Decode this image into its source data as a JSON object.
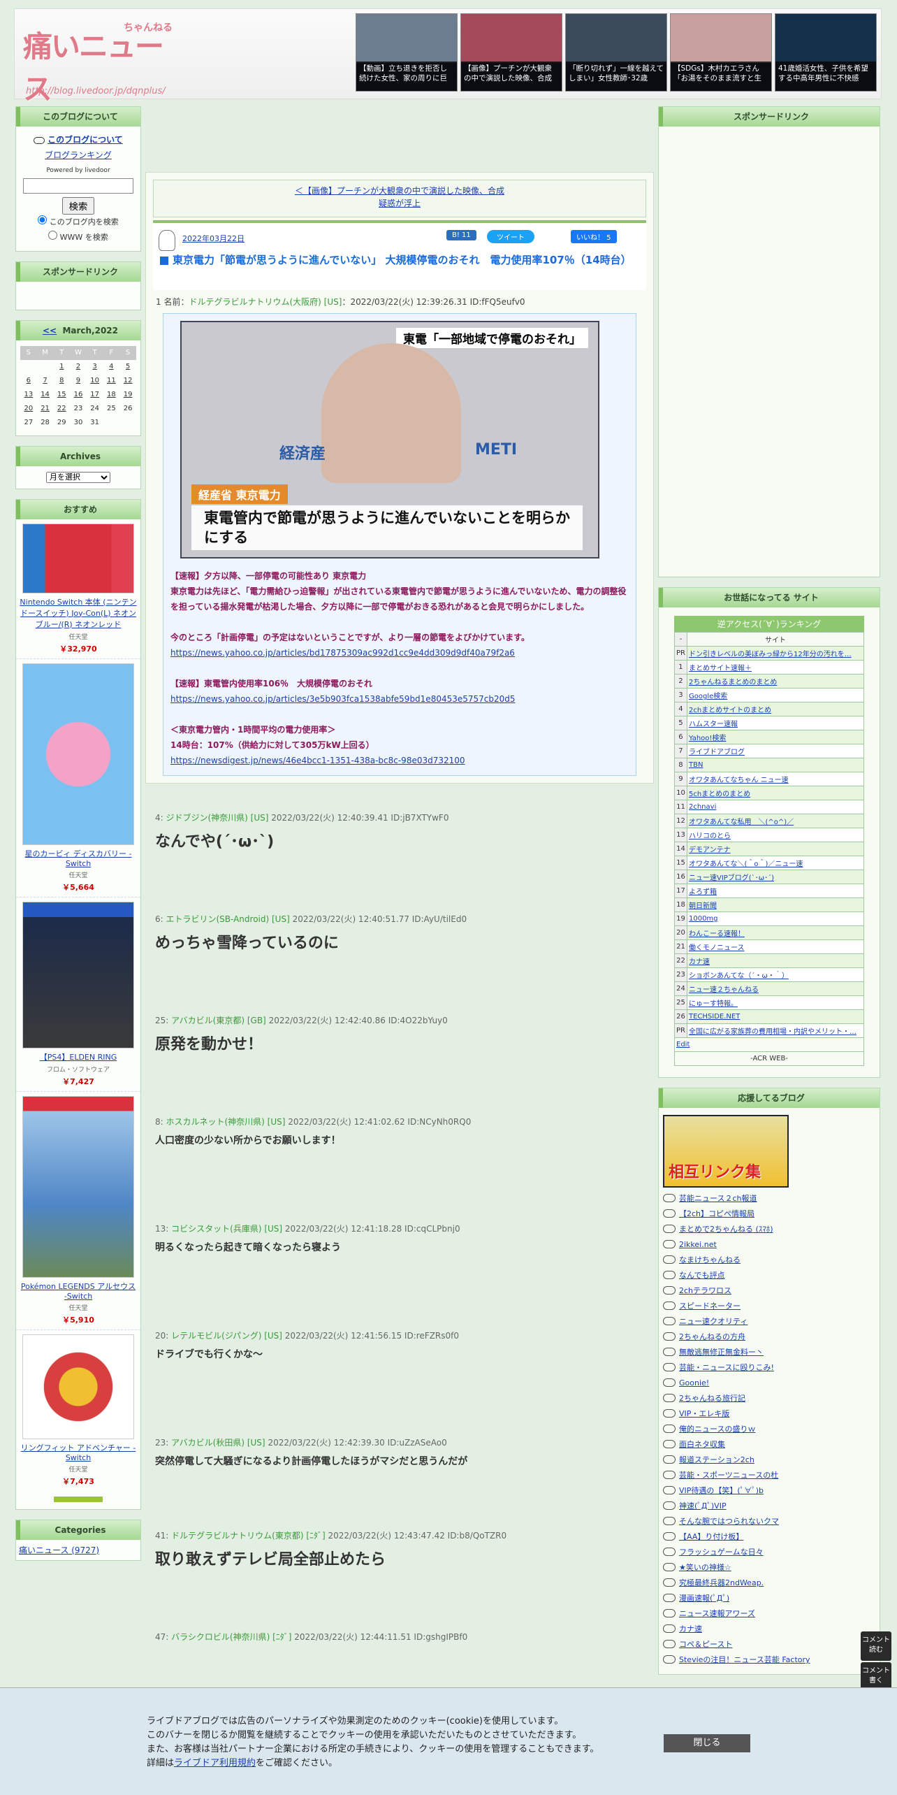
{
  "header": {
    "logo_main": "痛いニュース",
    "logo_sub": "ちゃんねる",
    "logo_url": "http://blog.livedoor.jp/dqnplus/",
    "thumbs": [
      {
        "caption": "【動画】立ち退きを拒否し続けた女性、家の周りに巨",
        "color": "#6b7d8f"
      },
      {
        "caption": "【画像】プーチンが大観衆の中で演説した映像、合成",
        "color": "#a44a5a"
      },
      {
        "caption": "「断り切れず」一線を越えてしまい」女性教師･32歳",
        "color": "#3b4b5c"
      },
      {
        "caption": "【SDGs】木村カエラさん「お湯をそのまま流すと生",
        "color": "#c9a0a0"
      },
      {
        "caption": "41歳婚活女性、子供を希望する中高年男性に不快感",
        "color": "#14304a"
      }
    ]
  },
  "left": {
    "about_title": "このブログについて",
    "about_link": "このブログについて",
    "ranking_link": "ブログランキング",
    "powered_by": "Powered by livedoor",
    "search_button": "検索",
    "radio_blog": "このブログ内を検索",
    "radio_www": "WWW を検索",
    "sponsor_title": "スポンサードリンク",
    "calendar": {
      "title": "March,2022",
      "prev": "<<",
      "days": [
        "S",
        "M",
        "T",
        "W",
        "T",
        "F",
        "S"
      ],
      "weeks": [
        [
          "",
          "",
          "1",
          "2",
          "3",
          "4",
          "5"
        ],
        [
          "6",
          "7",
          "8",
          "9",
          "10",
          "11",
          "12"
        ],
        [
          "13",
          "14",
          "15",
          "16",
          "17",
          "18",
          "19"
        ],
        [
          "20",
          "21",
          "22",
          "23",
          "24",
          "25",
          "26"
        ],
        [
          "27",
          "28",
          "29",
          "30",
          "31",
          "",
          ""
        ]
      ]
    },
    "archives_title": "Archives",
    "archives_select": "月を選択",
    "recommend_title": "おすすめ",
    "products": [
      {
        "name": "Nintendo Switch 本体 (ニンテンドースイッチ) Joy-Con(L) ネオンブルー/(R) ネオンレッド",
        "seller": "任天堂",
        "price": "￥32,970",
        "color": "#d9323c"
      },
      {
        "name": "星のカービィ ディスカバリー -Switch",
        "seller": "任天堂",
        "price": "￥5,664",
        "color": "#f2a5c5"
      },
      {
        "name": "【PS4】ELDEN RING",
        "seller": "フロム・ソフトウェア",
        "price": "￥7,427",
        "color": "#1c2b4a"
      },
      {
        "name": "Pokémon LEGENDS アルセウス -Switch",
        "seller": "任天堂",
        "price": "￥5,910",
        "color": "#4f86c6"
      },
      {
        "name": "リングフィット アドベンチャー -Switch",
        "seller": "任天堂",
        "price": "￥7,473",
        "color": "#d84040"
      }
    ],
    "categories_title": "Categories",
    "category_first": "痛いニュース (9727)"
  },
  "main": {
    "nav_prev": "＜【画像】プーチンが大観衆の中で演説した映像、合成",
    "nav_prev2": "疑惑が浮上",
    "date": "2022年03月22日",
    "share_b": "B! 11",
    "share_tweet": "ツイート",
    "share_like": "いいね！ 5",
    "title": "東京電力「節電が思うように進んでいない」 大規模停電のおそれ　電力使用率107％（14時台）",
    "op_num": "1",
    "op_name_label": "名前：",
    "op_name": "ドルテグラビルナトリウム(大阪府) [US]",
    "op_meta": "：2022/03/22(火) 12:39:26.31 ID:fFQ5eufv0",
    "img_caption_top": "東電「一部地域で停電のおそれ」",
    "img_tag": "経産省 東京電力",
    "img_caption": "東電管内で節電が思うように進んでいないことを明らかにする",
    "img_logo1": "経済産",
    "img_logo2": "METI",
    "quote_lines": [
      "【速報】夕方以降、一部停電の可能性あり 東京電力",
      "東京電力は先ほど、「電力需給ひっ迫警報」が出されている東電管内で節電が思うように進んでいないため、電力の調整役を担っている揚水発電が枯渇した場合、夕方以降に一部で停電がおきる恐れがあると会見で明らかにしました。",
      "",
      "今のところ「計画停電」の予定はないということですが、より一層の節電をよびかけています。"
    ],
    "link1": "https://news.yahoo.co.jp/articles/bd17875309ac992d1cc9e4dd309d9df40a79f2a6",
    "quote2": "【速報】東電管内使用率106％　大規模停電のおそれ",
    "link2": "https://news.yahoo.co.jp/articles/3e5b903fca1538abfe59bd1e80453e5757cb20d5",
    "quote3a": "＜東京電力管内・1時間平均の電力使用率＞",
    "quote3b": "14時台：107%（供給力に対して305万kW上回る）",
    "link3": "https://newsdigest.jp/news/46e4bcc1-1351-438a-bc8c-98e03d732100",
    "responses": [
      {
        "num": "4",
        "name": "ジドブジン(神奈川県) [US]",
        "meta": "2022/03/22(火) 12:40:39.41 ID:jB7XTYwF0",
        "body": "なんでや(´･ω･`)",
        "size": "22px"
      },
      {
        "num": "6",
        "name": "エトラビリン(SB-Android) [US]",
        "meta": "2022/03/22(火) 12:40:51.77 ID:AyU/tilEd0",
        "body": "めっちゃ雪降っているのに",
        "size": "22px"
      },
      {
        "num": "25",
        "name": "アバカビル(東京都) [GB]",
        "meta": "2022/03/22(火) 12:42:40.86 ID:4O22bYuy0",
        "body": "原発を動かせ！",
        "size": "22px"
      },
      {
        "num": "8",
        "name": "ホスカルネット(神奈川県) [US]",
        "meta": "2022/03/22(火) 12:41:02.62 ID:NCyNh0RQ0",
        "body": "人口密度の少ない所からでお願いします！",
        "size": "14px"
      },
      {
        "num": "13",
        "name": "コビシスタット(兵庫県) [US]",
        "meta": "2022/03/22(火) 12:41:18.28 ID:cqCLPbnj0",
        "body": "明るくなったら起きて暗くなったら寝よう",
        "size": "14px"
      },
      {
        "num": "20",
        "name": "レテルモビル(ジパング) [US]",
        "meta": "2022/03/22(火) 12:41:56.15 ID:reFZRs0f0",
        "body": "ドライブでも行くかな～",
        "size": "14px"
      },
      {
        "num": "23",
        "name": "アバカビル(秋田県) [US]",
        "meta": "2022/03/22(火) 12:42:39.30 ID:uZzASeAo0",
        "body": "突然停電して大騒ぎになるより計画停電したほうがマシだと思うんだが",
        "size": "14px"
      },
      {
        "num": "41",
        "name": "ドルテグラビルナトリウム(東京都) [ﾆﾀﾞ]",
        "meta": "2022/03/22(火) 12:43:47.42 ID:b8/QoTZR0",
        "body": "取り敢えずテレビ局全部止めたら",
        "size": "22px"
      },
      {
        "num": "47",
        "name": "バラシクロビル(神奈川県) [ﾆﾀﾞ]",
        "meta": "2022/03/22(火) 12:44:11.51 ID:gshgIPBf0",
        "body": "",
        "size": "14px"
      }
    ]
  },
  "right": {
    "sponsor_title": "スポンサードリンク",
    "care_title": "お世話になってる サイト",
    "rank_title": "逆アクセス(´∀`)ランキング",
    "rank_header": [
      "-",
      "サイト"
    ],
    "ranking": [
      [
        "PR",
        "ドン引きレベルの美ぼみっ緑から12年分の汚れを…"
      ],
      [
        "1",
        "まとめサイト速報＋"
      ],
      [
        "2",
        "2ちゃんねるまとめのまとめ"
      ],
      [
        "3",
        "Google検索"
      ],
      [
        "4",
        "2chまとめサイトのまとめ"
      ],
      [
        "5",
        "ハムスター速報"
      ],
      [
        "6",
        "Yahoo!検索"
      ],
      [
        "7",
        "ライブドアブログ"
      ],
      [
        "8",
        "TBN"
      ],
      [
        "9",
        "オワタあんてなちゃん ニュー速"
      ],
      [
        "10",
        "5chまとめのまとめ"
      ],
      [
        "11",
        "2chnavi"
      ],
      [
        "12",
        "オワタあんてな私用　＼(^o^)／"
      ],
      [
        "13",
        "ハリコのとら"
      ],
      [
        "14",
        "デモアンテナ"
      ],
      [
        "15",
        "オワタあんてな＼(＾o＾)／ニュー速"
      ],
      [
        "16",
        "ニュー速VIPブログ(`･ω･´)"
      ],
      [
        "17",
        "よろず箱"
      ],
      [
        "18",
        "朝日新聞"
      ],
      [
        "19",
        "1000mg"
      ],
      [
        "20",
        "わんこーる速報！"
      ],
      [
        "21",
        "働くモノニュース"
      ],
      [
        "22",
        "カナ速"
      ],
      [
        "23",
        "ショボンあんてな（´・ω・｀）"
      ],
      [
        "24",
        "ニュー速２ちゃんねる"
      ],
      [
        "25",
        "にゅーす特報。"
      ],
      [
        "26",
        "TECHSIDE.NET"
      ],
      [
        "PR",
        "全国に広がる家族葬の費用相場・内訳やメリット・…"
      ]
    ],
    "rank_edit": "Edit",
    "rank_footer": "-ACR WEB-",
    "support_title": "応援してるブログ",
    "banner_text": "相互リンク集",
    "blogs": [
      "芸能ニュース２ch報道",
      "【2ch】コピペ情報局",
      "まとめで2ちゃんねる (ｽﾏﾎ)",
      "2ikkei.net",
      "なまけちゃんねる",
      "なんでも評点",
      "2chテラワロス",
      "スピードネーター",
      "ニュー速クオリティ",
      "2ちゃんねるの方舟",
      "無敵逃無修正無金料ー丶",
      "芸能・ニュースに殴りこみ!",
      "Goonie!",
      "2ちゃんねる旅行記",
      "VIP・エレキ版",
      "俺的ニュースの盛りｗ",
      "面白ネタ収集",
      "報道ステーション2ch",
      "芸能・スポーツニュースの杜",
      "VIP待遇の【笑】(ﾟ∀ﾟ)b",
      "神速(ﾟДﾟ)VIP",
      "そんな腕ではつられないクマ",
      "【AA】り付け板】",
      "フラッシュゲームな日々",
      "★笑いの神様☆",
      "究極最終兵器2ndWeap.",
      "漫画速報(ﾟДﾟ)",
      "ニュース速報アワーズ",
      "カナ速",
      "コペ＆ピースト",
      "Stevieの注目！ニュース芸能 Factory"
    ],
    "comment_read": "コメント読む",
    "comment_write": "コメント書く"
  },
  "cookie": {
    "lines": [
      "ライブドアブログでは広告のパーソナライズや効果測定のためのクッキー(cookie)を使用しています。",
      "このバナーを閉じるか閲覧を継続することでクッキーの使用を承認いただいたものとさせていただきます。",
      "また、お客様は当社パートナー企業における所定の手続きにより、クッキーの使用を管理することもできます。"
    ],
    "line4_pre": "詳細は",
    "line4_link": "ライブドア利用規約",
    "line4_post": "をご確認ください。",
    "close": "閉じる"
  }
}
